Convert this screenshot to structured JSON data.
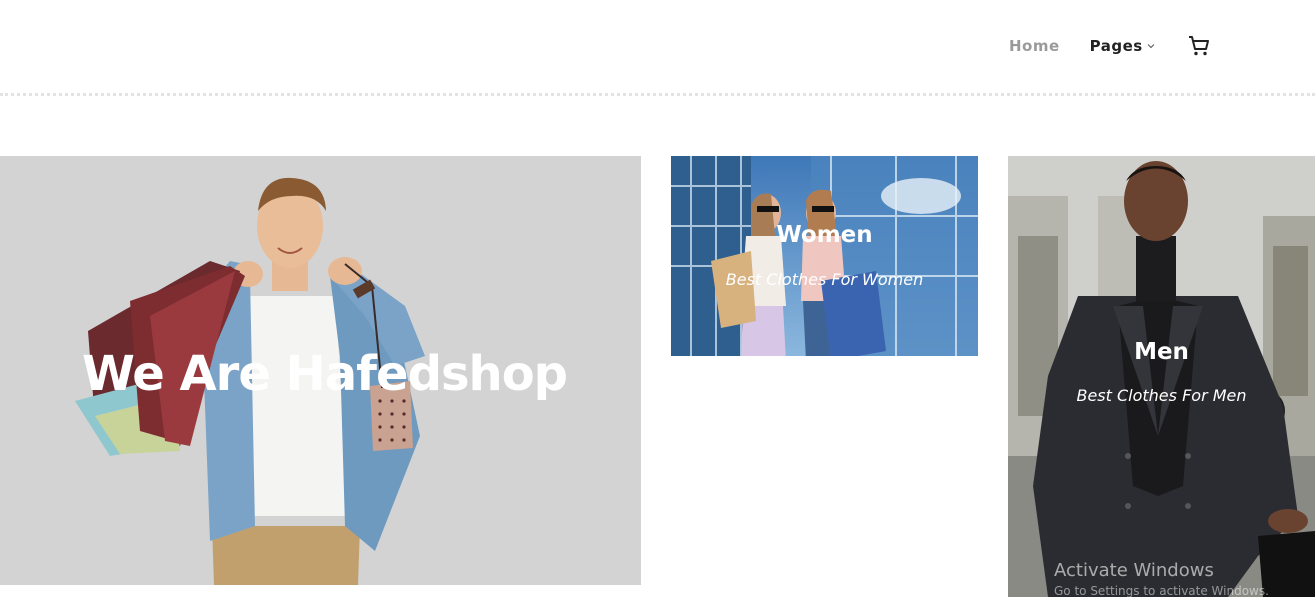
{
  "nav": {
    "home_label": "Home",
    "pages_label": "Pages",
    "cart_icon": "cart-icon"
  },
  "hero": {
    "title": "We Are Hafedshop"
  },
  "categories": [
    {
      "title": "Women",
      "subtitle": "Best Clothes For Women"
    },
    {
      "title": "Men",
      "subtitle": "Best Clothes For Men"
    }
  ],
  "system": {
    "watermark_title": "Activate Windows",
    "watermark_sub": "Go to Settings to activate Windows."
  },
  "colors": {
    "hero_bg": "#d3d3d3",
    "nav_inactive": "#9a9a9a",
    "nav_active": "#222222"
  }
}
